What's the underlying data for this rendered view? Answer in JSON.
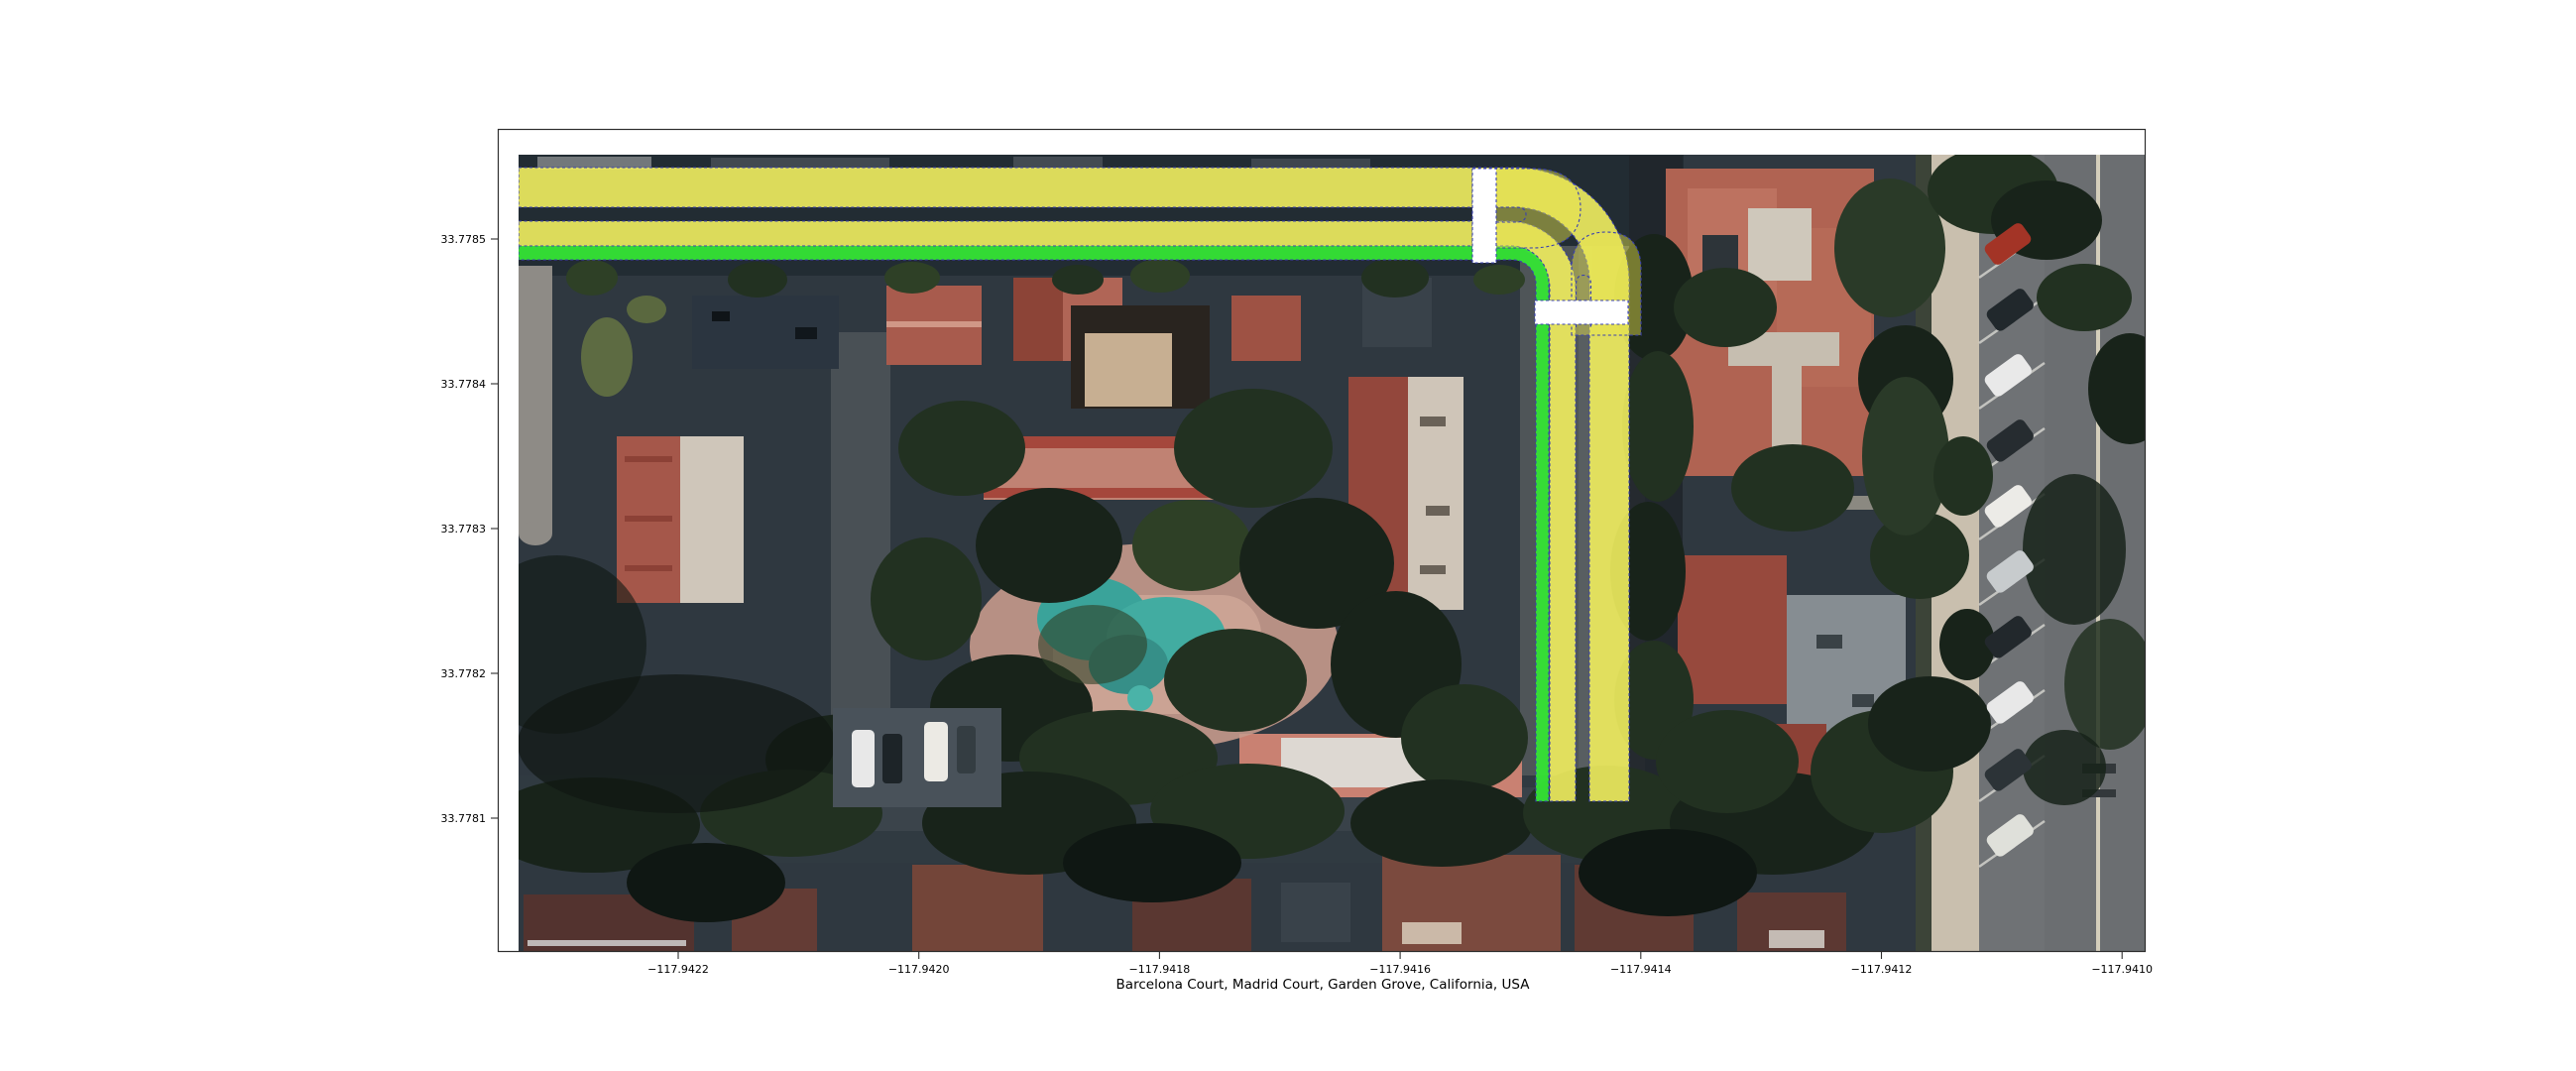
{
  "figure": {
    "title": "Barcelona Court, Madrid Court, Garden Grove, California, USA"
  },
  "axes": {
    "y_ticks": [
      "33.7785",
      "33.7784",
      "33.7783",
      "33.7782",
      "33.7781"
    ],
    "x_ticks": [
      "−117.9422",
      "−117.9420",
      "−117.9418",
      "−117.9416",
      "−117.9414",
      "−117.9412",
      "−117.9410"
    ]
  },
  "overlay": {
    "lane_fill_yellow": "#f1ee5f",
    "edge_line_green": "#35e435",
    "boundary_dash_blue": "#3a41b0",
    "crosswalk_white": "#ffffff"
  }
}
